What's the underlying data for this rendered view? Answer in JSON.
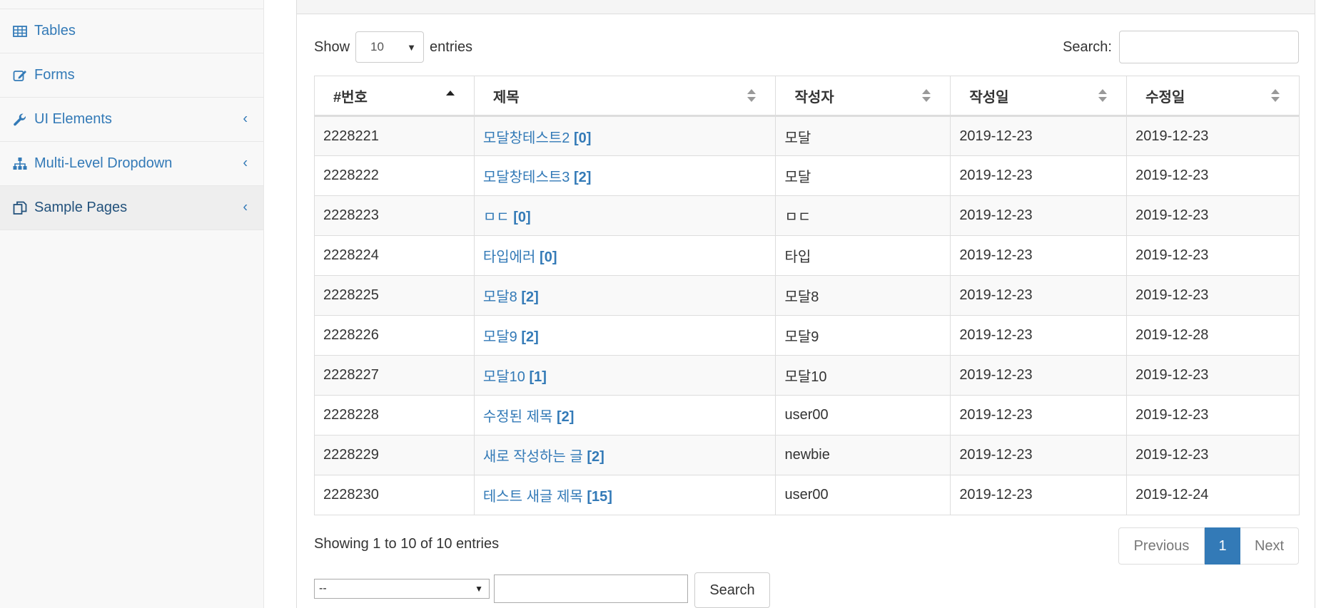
{
  "sidebar": {
    "items": [
      {
        "label": "Tables",
        "icon": "table-icon",
        "has_submenu": false
      },
      {
        "label": "Forms",
        "icon": "edit-icon",
        "has_submenu": false
      },
      {
        "label": "UI Elements",
        "icon": "wrench-icon",
        "has_submenu": true
      },
      {
        "label": "Multi-Level Dropdown",
        "icon": "sitemap-icon",
        "has_submenu": true
      },
      {
        "label": "Sample Pages",
        "icon": "files-icon",
        "has_submenu": true
      }
    ],
    "chevron": "‹"
  },
  "controls": {
    "show_label": "Show",
    "length_value": "10",
    "entries_label": "entries",
    "search_label": "Search:",
    "search_value": ""
  },
  "table": {
    "headers": [
      "#번호",
      "제목",
      "작성자",
      "작성일",
      "수정일"
    ],
    "rows": [
      {
        "id": "2228221",
        "title": "모달창테스트2",
        "count": "[0]",
        "author": "모달",
        "created": "2019-12-23",
        "modified": "2019-12-23"
      },
      {
        "id": "2228222",
        "title": "모달창테스트3",
        "count": "[2]",
        "author": "모달",
        "created": "2019-12-23",
        "modified": "2019-12-23"
      },
      {
        "id": "2228223",
        "title": "ㅁㄷ",
        "count": "[0]",
        "author": "ㅁㄷ",
        "created": "2019-12-23",
        "modified": "2019-12-23"
      },
      {
        "id": "2228224",
        "title": "타입에러",
        "count": "[0]",
        "author": "타입",
        "created": "2019-12-23",
        "modified": "2019-12-23"
      },
      {
        "id": "2228225",
        "title": "모달8",
        "count": "[2]",
        "author": "모달8",
        "created": "2019-12-23",
        "modified": "2019-12-23"
      },
      {
        "id": "2228226",
        "title": "모달9",
        "count": "[2]",
        "author": "모달9",
        "created": "2019-12-23",
        "modified": "2019-12-28"
      },
      {
        "id": "2228227",
        "title": "모달10",
        "count": "[1]",
        "author": "모달10",
        "created": "2019-12-23",
        "modified": "2019-12-23"
      },
      {
        "id": "2228228",
        "title": "수정된 제목",
        "count": "[2]",
        "author": "user00",
        "created": "2019-12-23",
        "modified": "2019-12-23"
      },
      {
        "id": "2228229",
        "title": "새로 작성하는 글",
        "count": "[2]",
        "author": "newbie",
        "created": "2019-12-23",
        "modified": "2019-12-23"
      },
      {
        "id": "2228230",
        "title": "테스트 새글 제목",
        "count": "[15]",
        "author": "user00",
        "created": "2019-12-23",
        "modified": "2019-12-24"
      }
    ]
  },
  "footer": {
    "info": "Showing 1 to 10 of 10 entries",
    "prev_label": "Previous",
    "current_page": "1",
    "next_label": "Next"
  },
  "bottom_search": {
    "type_value": "--",
    "keyword_value": "",
    "button_label": "Search"
  },
  "colors": {
    "link": "#337ab7",
    "active_page_bg": "#337ab7",
    "sidebar_bg": "#f8f8f8"
  }
}
